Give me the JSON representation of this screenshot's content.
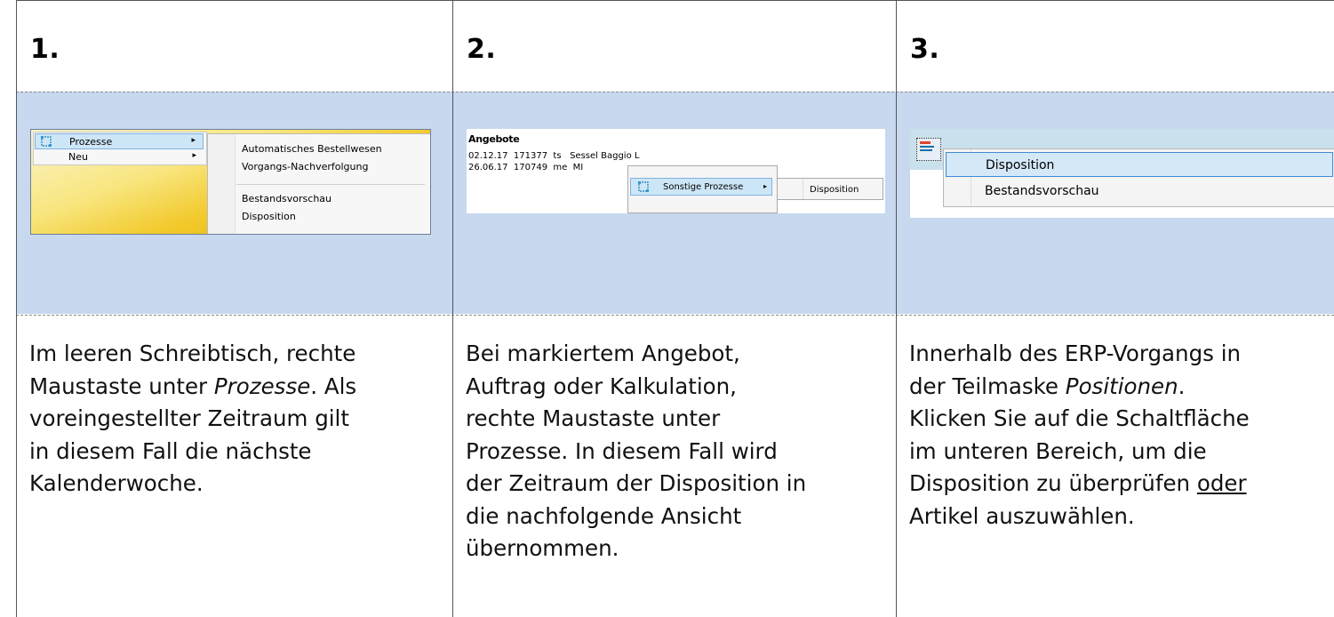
{
  "columns": [
    {
      "number": "1.",
      "text_parts": [
        "Im leeren Schreibtisch, rechte",
        "Maustaste unter ",
        "Prozesse",
        ". Als",
        "voreingestellter Zeitraum gilt",
        "in diesem Fall die nächste",
        "Kalenderwoche."
      ],
      "screenshot": {
        "context_menu": [
          {
            "label": "Prozesse",
            "arrow": "▸",
            "selected": true
          },
          {
            "label": "Neu",
            "arrow": "▸",
            "selected": false
          }
        ],
        "submenu": [
          "Automatisches Bestellwesen",
          "Vorgangs-Nachverfolgung",
          "Bestandsvorschau",
          "Disposition"
        ]
      }
    },
    {
      "number": "2.",
      "text_lines": [
        "Bei markiertem Angebot,",
        "Auftrag oder Kalkulation,",
        "rechte Maustaste unter",
        "Prozesse. In diesem Fall wird",
        "der Zeitraum der Disposition in",
        "die nachfolgende Ansicht",
        "übernommen."
      ],
      "screenshot": {
        "header": "Angebote",
        "rows": [
          "02.12.17  171377  ts   Sessel Baggio L",
          "26.06.17  170749  me  MI"
        ],
        "menu_item": "Sonstige Prozesse",
        "menu_arrow": "▸",
        "submenu_item": "Disposition"
      }
    },
    {
      "number": "3.",
      "text_parts": [
        "Innerhalb des ERP-Vorgangs in",
        "der Teilmaske ",
        "Positionen",
        ".",
        "Klicken Sie auf die Schaltfläche",
        "im unteren Bereich, um die",
        "Disposition zu überprüfen ",
        "oder",
        "Artikel auszuwählen."
      ],
      "screenshot": {
        "menu": [
          "Disposition",
          "Bestandsvorschau"
        ]
      }
    }
  ],
  "colors": {
    "band": "#c7d8ef",
    "selection": "#cde6f7",
    "selection_border": "#3d8ad6"
  }
}
